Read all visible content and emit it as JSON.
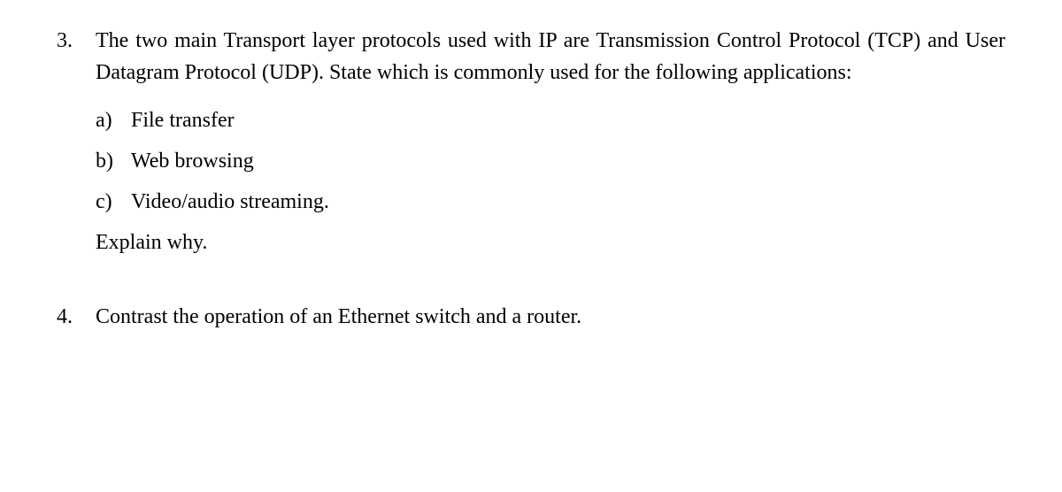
{
  "questions": [
    {
      "number": "3.",
      "text": "The two main Transport layer protocols used with IP are Transmission Control Protocol (TCP) and User Datagram Protocol (UDP). State which is commonly used for the following applications:",
      "sub": [
        {
          "letter": "a)",
          "text": "File transfer"
        },
        {
          "letter": "b)",
          "text": "Web browsing"
        },
        {
          "letter": "c)",
          "text": "Video/audio streaming."
        }
      ],
      "explain": "Explain why."
    },
    {
      "number": "4.",
      "text": "Contrast the operation of an Ethernet switch and a router."
    }
  ]
}
